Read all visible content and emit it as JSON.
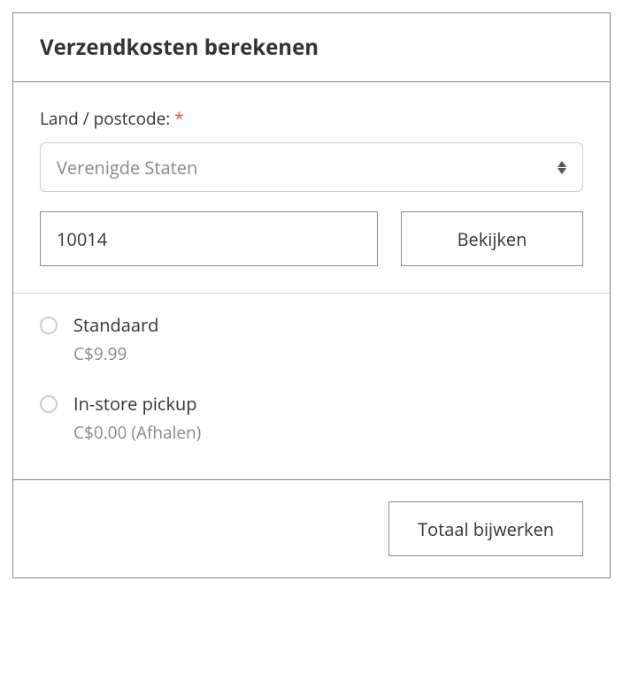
{
  "header": {
    "title": "Verzendkosten berekenen"
  },
  "form": {
    "label": "Land / postcode:",
    "required_mark": "*",
    "country_value": "Verenigde Staten",
    "postcode_value": "10014",
    "lookup_button": "Bekijken"
  },
  "shipping_options": [
    {
      "title": "Standaard",
      "subtitle": "C$9.99"
    },
    {
      "title": "In-store pickup",
      "subtitle": "C$0.00 (Afhalen)"
    }
  ],
  "footer": {
    "update_button": "Totaal bijwerken"
  }
}
